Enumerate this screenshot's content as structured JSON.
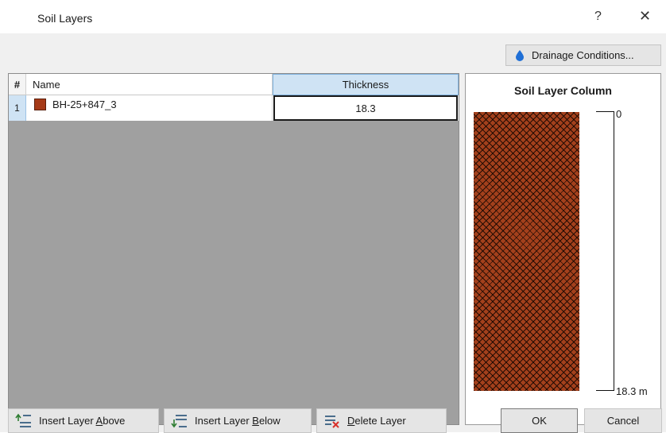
{
  "window": {
    "title": "Soil Layers",
    "help": "?",
    "close": "✕"
  },
  "drainage_button": {
    "label": "Drainage Conditions..."
  },
  "grid": {
    "columns": {
      "num": "#",
      "name": "Name",
      "thickness": "Thickness"
    },
    "rows": [
      {
        "num": "1",
        "name": "BH-25+847_3",
        "color": "#a63a17",
        "thickness": "18.3"
      }
    ]
  },
  "preview": {
    "title": "Soil Layer Column",
    "top_label": "0",
    "bottom_label": "18.3 m",
    "fill_color": "#a3401c"
  },
  "buttons": {
    "insert_above": {
      "pre": "Insert Layer ",
      "key": "A",
      "post": "bove"
    },
    "insert_below": {
      "pre": "Insert Layer ",
      "key": "B",
      "post": "elow"
    },
    "delete": {
      "pre": "",
      "key": "D",
      "post": "elete Layer"
    },
    "ok": "OK",
    "cancel": "Cancel"
  },
  "colors": {
    "selection_blue": "#cfe3f4",
    "drop_blue": "#1f6fd6",
    "delete_red": "#d9302a"
  },
  "icons": [
    "water-drop-icon",
    "insert-above-icon",
    "insert-below-icon",
    "delete-layer-icon"
  ]
}
